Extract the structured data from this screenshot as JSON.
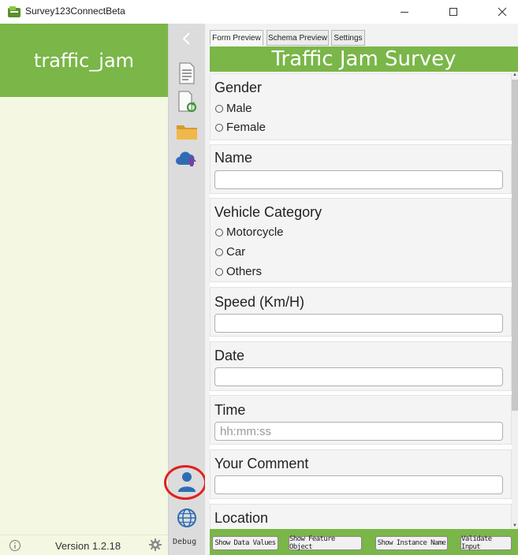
{
  "window": {
    "title": "Survey123ConnectBeta",
    "icons": {
      "app": "survey123-app-icon",
      "minimize": "minimize-icon",
      "maximize": "maximize-icon",
      "close": "close-icon"
    }
  },
  "left_panel": {
    "survey_name": "traffic_jam",
    "version": "Version 1.2.18",
    "icons": {
      "info": "info-icon",
      "settings": "gear-icon"
    }
  },
  "tool_strip": {
    "icons": [
      "back-chevron-icon",
      "form-document-icon",
      "refresh-document-icon",
      "folder-icon",
      "cloud-upload-icon",
      "user-icon",
      "globe-icon"
    ],
    "debug_label": "Debug"
  },
  "tabs": [
    {
      "label": "Form Preview",
      "selected": true
    },
    {
      "label": "Schema Preview",
      "selected": false
    },
    {
      "label": "Settings",
      "selected": false
    }
  ],
  "form": {
    "title": "Traffic Jam Survey",
    "questions": {
      "gender": {
        "label": "Gender",
        "options": [
          "Male",
          "Female"
        ]
      },
      "name": {
        "label": "Name",
        "value": ""
      },
      "vehicle": {
        "label": "Vehicle Category",
        "options": [
          "Motorcycle",
          "Car",
          "Others"
        ]
      },
      "speed": {
        "label": "Speed (Km/H)",
        "value": ""
      },
      "date": {
        "label": "Date",
        "value": ""
      },
      "time": {
        "label": "Time",
        "placeholder": "hh:mm:ss"
      },
      "comment": {
        "label": "Your Comment",
        "value": ""
      },
      "location": {
        "label": "Location"
      }
    }
  },
  "bottom_buttons": {
    "data_values": "Show Data Values",
    "feature_object": "Show Feature Object",
    "instance_name": "Show Instance Name",
    "validate": "Validate Input"
  },
  "colors": {
    "accent_green": "#7ab648",
    "highlight_red": "#e02020",
    "panel_bg": "#f4f8e2"
  }
}
